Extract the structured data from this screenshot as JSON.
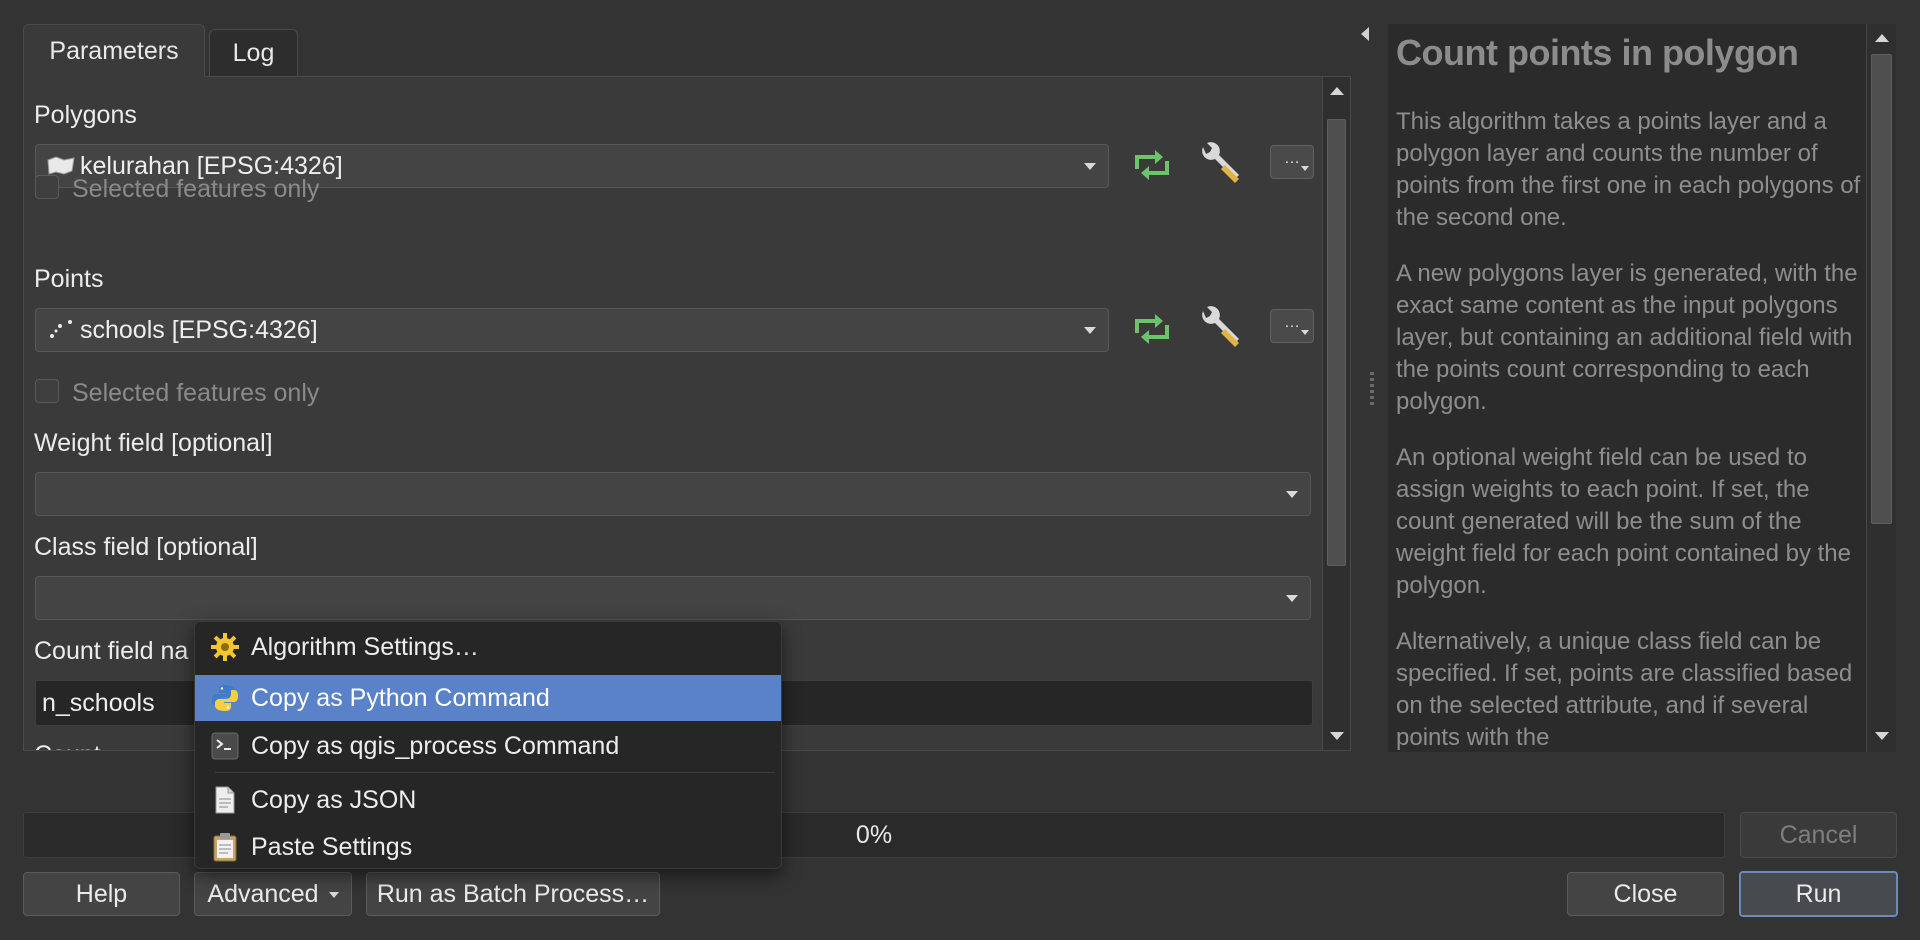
{
  "tabs": [
    {
      "label": "Parameters",
      "active": true
    },
    {
      "label": "Log",
      "active": false
    }
  ],
  "params": {
    "polygons_label": "Polygons",
    "polygons_value": "kelurahan [EPSG:4326]",
    "polygons_selected_only": "Selected features only",
    "points_label": "Points",
    "points_value": "schools [EPSG:4326]",
    "points_selected_only": "Selected features only",
    "weight_label": "Weight field [optional]",
    "weight_value": "",
    "class_label": "Class field [optional]",
    "class_value": "",
    "count_label": "Count field na",
    "count_value": "n_schools",
    "count_cut_label": "Count",
    "ellipsis": "…"
  },
  "help": {
    "title": "Count points in polygon",
    "paragraphs": [
      "This algorithm takes a points layer and a polygon layer and counts the number of points from the first one in each polygons of the second one.",
      "A new polygons layer is generated, with the exact same content as the input polygons layer, but containing an additional field with the points count corresponding to each polygon.",
      "An optional weight field can be used to assign weights to each point. If set, the count generated will be the sum of the weight field for each point contained by the polygon.",
      "Alternatively, a unique class field can be specified. If set, points are classified based on the selected attribute, and if several points with the"
    ]
  },
  "progress": {
    "text": "0%",
    "value": 0
  },
  "buttons": {
    "cancel": "Cancel",
    "help": "Help",
    "advanced": "Advanced",
    "batch": "Run as Batch Process…",
    "close": "Close",
    "run": "Run"
  },
  "menu": {
    "items": [
      {
        "label": "Algorithm Settings…",
        "icon": "gear-icon",
        "highlighted": false
      },
      {
        "label": "Copy as Python Command",
        "icon": "python-icon",
        "highlighted": true
      },
      {
        "label": "Copy as qgis_process Command",
        "icon": "terminal-icon",
        "highlighted": false
      },
      {
        "label": "Copy as JSON",
        "icon": "document-icon",
        "highlighted": false
      },
      {
        "label": "Paste Settings",
        "icon": "clipboard-icon",
        "highlighted": false
      }
    ]
  },
  "colors": {
    "background": "#333333",
    "highlight": "#5a82c9",
    "accent_green": "#6cc36c",
    "run_border": "#6d8ab8"
  }
}
